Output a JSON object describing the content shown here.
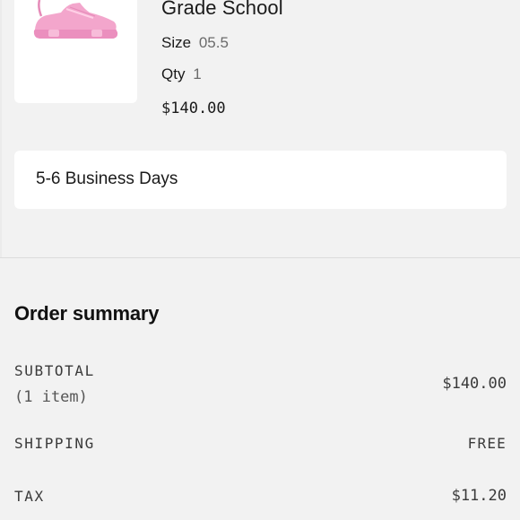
{
  "product": {
    "name": "Grade School",
    "size_label": "Size",
    "size_value": "05.5",
    "qty_label": "Qty",
    "qty_value": "1",
    "price": "$140.00",
    "image_icon": "pink-sneaker-image"
  },
  "delivery": {
    "estimate": "5-6 Business Days"
  },
  "summary": {
    "title": "Order summary",
    "subtotal_label": "SUBTOTAL",
    "items_count": "(1 item)",
    "subtotal_value": "$140.00",
    "shipping_label": "SHIPPING",
    "shipping_value": "FREE",
    "tax_label": "TAX",
    "tax_value": "$11.20"
  },
  "colors": {
    "background": "#f2f2f2",
    "card": "#ffffff",
    "sneaker": "#f3a6cc"
  }
}
